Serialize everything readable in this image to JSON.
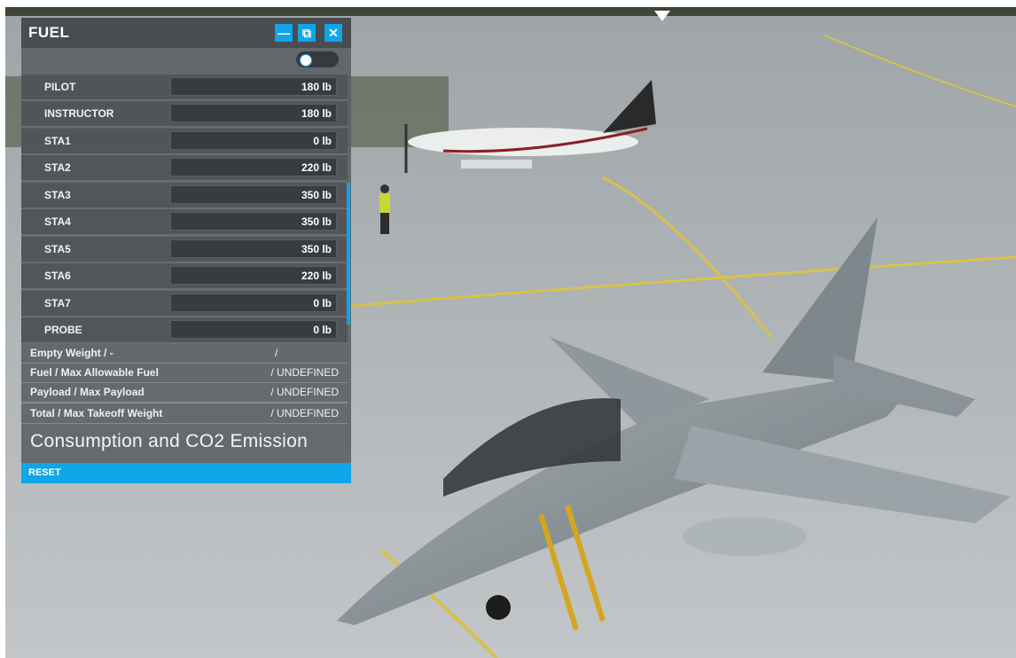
{
  "panel": {
    "title": "FUEL",
    "window_buttons": [
      {
        "name": "minimize",
        "icon": "minus-icon",
        "glyph": "—"
      },
      {
        "name": "undock",
        "icon": "external-window-icon",
        "glyph": "⧉"
      },
      {
        "name": "close",
        "icon": "close-icon",
        "glyph": "✕"
      }
    ],
    "toggle": {
      "state": "off"
    },
    "rows": [
      {
        "label": "PILOT",
        "value": "180 lb"
      },
      {
        "label": "INSTRUCTOR",
        "value": "180 lb"
      },
      {
        "label": "STA1",
        "value": "0 lb"
      },
      {
        "label": "STA2",
        "value": "220 lb"
      },
      {
        "label": "STA3",
        "value": "350 lb"
      },
      {
        "label": "STA4",
        "value": "350 lb"
      },
      {
        "label": "STA5",
        "value": "350 lb"
      },
      {
        "label": "STA6",
        "value": "220 lb"
      },
      {
        "label": "STA7",
        "value": "0 lb"
      },
      {
        "label": "PROBE",
        "value": "0 lb"
      }
    ],
    "summary": [
      {
        "label": "Empty Weight / -",
        "value": "/"
      },
      {
        "label": "Fuel / Max Allowable Fuel",
        "value": "/ UNDEFINED"
      },
      {
        "label": "Payload / Max Payload",
        "value": "/ UNDEFINED"
      },
      {
        "label": "Total / Max Takeoff Weight",
        "value": "/ UNDEFINED"
      }
    ],
    "consumption_heading": "Consumption and CO2 Emission",
    "reset_label": "RESET"
  },
  "colors": {
    "accent": "#0fa5e9",
    "panel_bg": "#5a5e62",
    "field_bg": "#383c40",
    "tarmac": "#b8bcc0",
    "jet": "#8a9398"
  }
}
